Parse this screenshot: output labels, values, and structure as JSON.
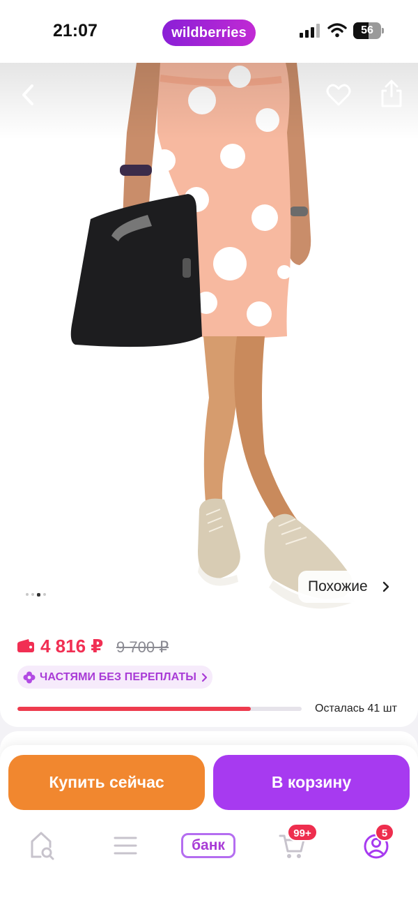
{
  "status_bar": {
    "time": "21:07",
    "brand": "wildberries",
    "battery": "56",
    "battery_level_percent": 56,
    "icons": [
      "signal-icon",
      "wifi-icon",
      "battery-icon"
    ]
  },
  "product": {
    "image": "photo-of-woman-in-peach-polka-dot-dress-with-black-bag-and-beige-sneakers",
    "carousel_total": 4,
    "carousel_active": 3,
    "similar_label": "Похожие",
    "icons": [
      "back-icon",
      "heart-icon",
      "share-icon",
      "chevron-right-icon"
    ]
  },
  "price": {
    "current": "4 816 ₽",
    "old": "9 700 ₽",
    "installment_label": "ЧАСТЯМИ БЕЗ ПЕРЕПЛАТЫ",
    "stock_text": "Осталась 41 шт",
    "stock_fill_fraction": 0.82,
    "icons": [
      "wallet-icon",
      "flower-icon"
    ]
  },
  "actions": {
    "buy_now": "Купить сейчас",
    "add_to_cart": "В корзину"
  },
  "tab_bar": {
    "bank_label": "банк",
    "cart_badge": "99+",
    "profile_badge": "5",
    "icons": [
      "home-search-icon",
      "menu-icon",
      "cart-icon",
      "profile-icon"
    ]
  },
  "colors": {
    "brand_gradient_start": "#8a1fd6",
    "brand_gradient_end": "#c12ad4",
    "price_red": "#f12f53",
    "buy_now_orange": "#f1872f",
    "cart_purple": "#a73af0",
    "installment_text": "#a83bd6",
    "badge_red": "#ee2e4e"
  }
}
